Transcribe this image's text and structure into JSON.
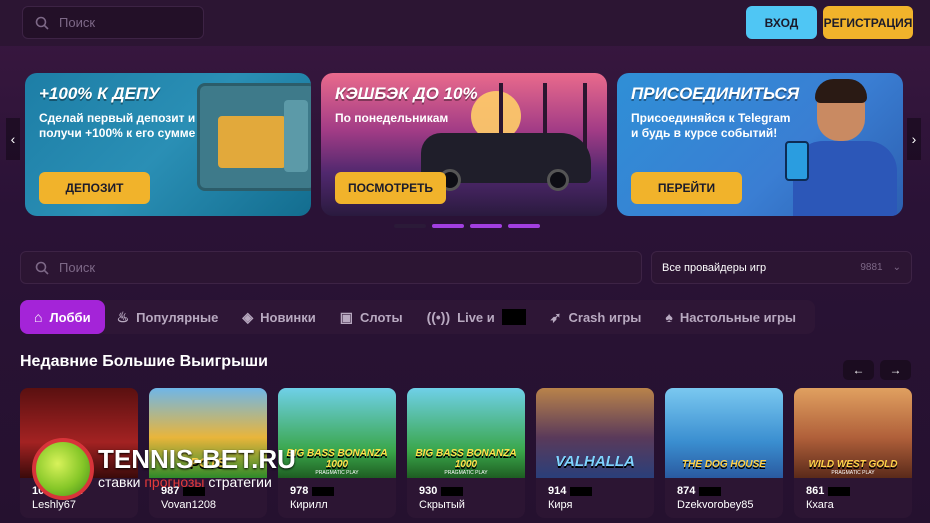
{
  "header": {
    "search_placeholder": "Поиск",
    "login_label": "ВХОД",
    "register_label": "РЕГИСТРАЦИЯ"
  },
  "banners": [
    {
      "title": "+100% К ДЕПУ",
      "desc": "Сделай первый депозит и получи +100% к его сумме",
      "button": "ДЕПОЗИТ"
    },
    {
      "title": "КЭШБЭК ДО 10%",
      "desc": "По понедельникам",
      "button": "ПОСМОТРЕТЬ"
    },
    {
      "title": "ПРИСОЕДИНИТЬСЯ",
      "desc": "Присоединяйся к Telegram и будь в курсе событий!",
      "button": "ПЕРЕЙТИ"
    }
  ],
  "carousel": {
    "prev_icon": "chevron-left-icon",
    "next_icon": "chevron-right-icon",
    "slides": 4,
    "active": 1
  },
  "game_search": {
    "placeholder": "Поиск"
  },
  "providers": {
    "label": "Все провайдеры игр",
    "count": "9881"
  },
  "tabs": [
    {
      "label": "Лобби",
      "icon": "home-icon",
      "active": true
    },
    {
      "label": "Популярные",
      "icon": "flame-icon"
    },
    {
      "label": "Новинки",
      "icon": "tag-icon"
    },
    {
      "label": "Слоты",
      "icon": "slot-icon"
    },
    {
      "label": "Live и",
      "icon": "live-icon"
    },
    {
      "label": "Crash игры",
      "icon": "rocket-icon"
    },
    {
      "label": "Настольные игры",
      "icon": "cards-icon"
    }
  ],
  "recent_wins": {
    "title": "Недавние Большие Выигрыши",
    "games": [
      {
        "amount": "1074 EUR",
        "user": "Leshly67"
      },
      {
        "amount": "987",
        "user": "Vovan1208",
        "game": "POTS"
      },
      {
        "amount": "978",
        "user": "Кирилл",
        "game": "BIG BASS BONANZA 1000"
      },
      {
        "amount": "930",
        "user": "Скрытый",
        "game": "BIG BASS BONANZA 1000"
      },
      {
        "amount": "914",
        "user": "Киря",
        "game": "VALHALLA"
      },
      {
        "amount": "874",
        "user": "Dzekvorobey85",
        "game": "THE DOG HOUSE"
      },
      {
        "amount": "861",
        "user": "Кхага",
        "game": "WILD WEST GOLD"
      }
    ],
    "provider_label": "PRAGMATIC PLAY"
  },
  "watermark": {
    "brand": "TENNIS-BET.RU",
    "tagline_1": "ставки",
    "tagline_2": "прогнозы",
    "tagline_3": "стратегии"
  },
  "colors": {
    "accent": "#a424d8",
    "login": "#4fc6f4",
    "cta": "#f1b32b",
    "bg": "#2a1236"
  }
}
